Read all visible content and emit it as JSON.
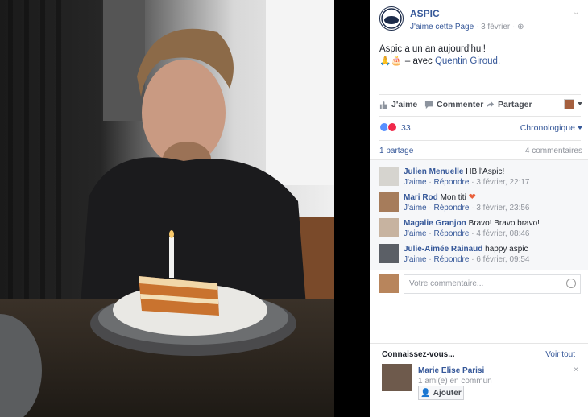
{
  "post": {
    "page_name": "ASPIC",
    "like_page": "J'aime cette Page",
    "date": "3 février",
    "sep": "·",
    "text": "Aspic a un an aujourd'hui!",
    "with_prefix": "– avec",
    "tagged_person": "Quentin Giroud."
  },
  "actions": {
    "like": "J'aime",
    "comment": "Commenter",
    "share": "Partager"
  },
  "stats": {
    "reactions": "33",
    "order": "Chronologique",
    "shares": "1 partage",
    "comments": "4 commentaires"
  },
  "comments": [
    {
      "author": "Julien Menuelle",
      "text": "HB l'Aspic!",
      "like": "J'aime",
      "reply": "Répondre",
      "time": "3 février, 22:17",
      "sep": "·"
    },
    {
      "author": "Mari Rod",
      "text": "Mon titi",
      "like": "J'aime",
      "reply": "Répondre",
      "time": "3 février, 23:56",
      "sep": "·"
    },
    {
      "author": "Magalie Granjon",
      "text": "Bravo! Bravo bravo!",
      "like": "J'aime",
      "reply": "Répondre",
      "time": "4 février, 08:46",
      "sep": "·"
    },
    {
      "author": "Julie-Aimée Rainaud",
      "text": "happy aspic",
      "like": "J'aime",
      "reply": "Répondre",
      "time": "6 février, 09:54",
      "sep": "·"
    }
  ],
  "comment_box": {
    "placeholder": "Votre commentaire..."
  },
  "suggest": {
    "title": "Connaissez-vous...",
    "see_all": "Voir tout",
    "name": "Marie Elise Parisi",
    "mutual": "1 ami(e) en commun",
    "add": "Ajouter",
    "close": "×"
  },
  "colors": {
    "link": "#365899",
    "muted": "#90949c",
    "like_reaction": "#5890ff",
    "love_reaction": "#f0284a"
  }
}
